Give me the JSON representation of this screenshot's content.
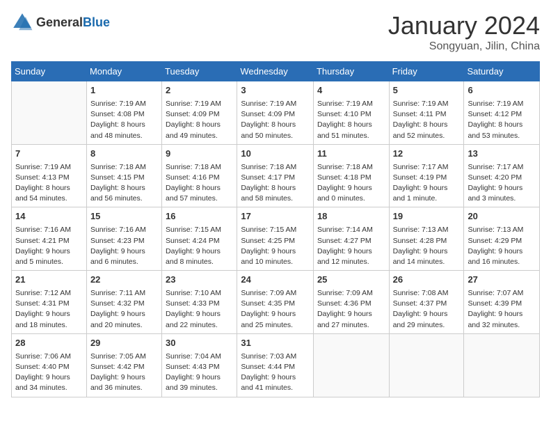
{
  "header": {
    "logo_general": "General",
    "logo_blue": "Blue",
    "month": "January 2024",
    "location": "Songyuan, Jilin, China"
  },
  "days_of_week": [
    "Sunday",
    "Monday",
    "Tuesday",
    "Wednesday",
    "Thursday",
    "Friday",
    "Saturday"
  ],
  "weeks": [
    [
      {
        "day": "",
        "info": ""
      },
      {
        "day": "1",
        "info": "Sunrise: 7:19 AM\nSunset: 4:08 PM\nDaylight: 8 hours\nand 48 minutes."
      },
      {
        "day": "2",
        "info": "Sunrise: 7:19 AM\nSunset: 4:09 PM\nDaylight: 8 hours\nand 49 minutes."
      },
      {
        "day": "3",
        "info": "Sunrise: 7:19 AM\nSunset: 4:09 PM\nDaylight: 8 hours\nand 50 minutes."
      },
      {
        "day": "4",
        "info": "Sunrise: 7:19 AM\nSunset: 4:10 PM\nDaylight: 8 hours\nand 51 minutes."
      },
      {
        "day": "5",
        "info": "Sunrise: 7:19 AM\nSunset: 4:11 PM\nDaylight: 8 hours\nand 52 minutes."
      },
      {
        "day": "6",
        "info": "Sunrise: 7:19 AM\nSunset: 4:12 PM\nDaylight: 8 hours\nand 53 minutes."
      }
    ],
    [
      {
        "day": "7",
        "info": "Sunrise: 7:19 AM\nSunset: 4:13 PM\nDaylight: 8 hours\nand 54 minutes."
      },
      {
        "day": "8",
        "info": "Sunrise: 7:18 AM\nSunset: 4:15 PM\nDaylight: 8 hours\nand 56 minutes."
      },
      {
        "day": "9",
        "info": "Sunrise: 7:18 AM\nSunset: 4:16 PM\nDaylight: 8 hours\nand 57 minutes."
      },
      {
        "day": "10",
        "info": "Sunrise: 7:18 AM\nSunset: 4:17 PM\nDaylight: 8 hours\nand 58 minutes."
      },
      {
        "day": "11",
        "info": "Sunrise: 7:18 AM\nSunset: 4:18 PM\nDaylight: 9 hours\nand 0 minutes."
      },
      {
        "day": "12",
        "info": "Sunrise: 7:17 AM\nSunset: 4:19 PM\nDaylight: 9 hours\nand 1 minute."
      },
      {
        "day": "13",
        "info": "Sunrise: 7:17 AM\nSunset: 4:20 PM\nDaylight: 9 hours\nand 3 minutes."
      }
    ],
    [
      {
        "day": "14",
        "info": "Sunrise: 7:16 AM\nSunset: 4:21 PM\nDaylight: 9 hours\nand 5 minutes."
      },
      {
        "day": "15",
        "info": "Sunrise: 7:16 AM\nSunset: 4:23 PM\nDaylight: 9 hours\nand 6 minutes."
      },
      {
        "day": "16",
        "info": "Sunrise: 7:15 AM\nSunset: 4:24 PM\nDaylight: 9 hours\nand 8 minutes."
      },
      {
        "day": "17",
        "info": "Sunrise: 7:15 AM\nSunset: 4:25 PM\nDaylight: 9 hours\nand 10 minutes."
      },
      {
        "day": "18",
        "info": "Sunrise: 7:14 AM\nSunset: 4:27 PM\nDaylight: 9 hours\nand 12 minutes."
      },
      {
        "day": "19",
        "info": "Sunrise: 7:13 AM\nSunset: 4:28 PM\nDaylight: 9 hours\nand 14 minutes."
      },
      {
        "day": "20",
        "info": "Sunrise: 7:13 AM\nSunset: 4:29 PM\nDaylight: 9 hours\nand 16 minutes."
      }
    ],
    [
      {
        "day": "21",
        "info": "Sunrise: 7:12 AM\nSunset: 4:31 PM\nDaylight: 9 hours\nand 18 minutes."
      },
      {
        "day": "22",
        "info": "Sunrise: 7:11 AM\nSunset: 4:32 PM\nDaylight: 9 hours\nand 20 minutes."
      },
      {
        "day": "23",
        "info": "Sunrise: 7:10 AM\nSunset: 4:33 PM\nDaylight: 9 hours\nand 22 minutes."
      },
      {
        "day": "24",
        "info": "Sunrise: 7:09 AM\nSunset: 4:35 PM\nDaylight: 9 hours\nand 25 minutes."
      },
      {
        "day": "25",
        "info": "Sunrise: 7:09 AM\nSunset: 4:36 PM\nDaylight: 9 hours\nand 27 minutes."
      },
      {
        "day": "26",
        "info": "Sunrise: 7:08 AM\nSunset: 4:37 PM\nDaylight: 9 hours\nand 29 minutes."
      },
      {
        "day": "27",
        "info": "Sunrise: 7:07 AM\nSunset: 4:39 PM\nDaylight: 9 hours\nand 32 minutes."
      }
    ],
    [
      {
        "day": "28",
        "info": "Sunrise: 7:06 AM\nSunset: 4:40 PM\nDaylight: 9 hours\nand 34 minutes."
      },
      {
        "day": "29",
        "info": "Sunrise: 7:05 AM\nSunset: 4:42 PM\nDaylight: 9 hours\nand 36 minutes."
      },
      {
        "day": "30",
        "info": "Sunrise: 7:04 AM\nSunset: 4:43 PM\nDaylight: 9 hours\nand 39 minutes."
      },
      {
        "day": "31",
        "info": "Sunrise: 7:03 AM\nSunset: 4:44 PM\nDaylight: 9 hours\nand 41 minutes."
      },
      {
        "day": "",
        "info": ""
      },
      {
        "day": "",
        "info": ""
      },
      {
        "day": "",
        "info": ""
      }
    ]
  ]
}
